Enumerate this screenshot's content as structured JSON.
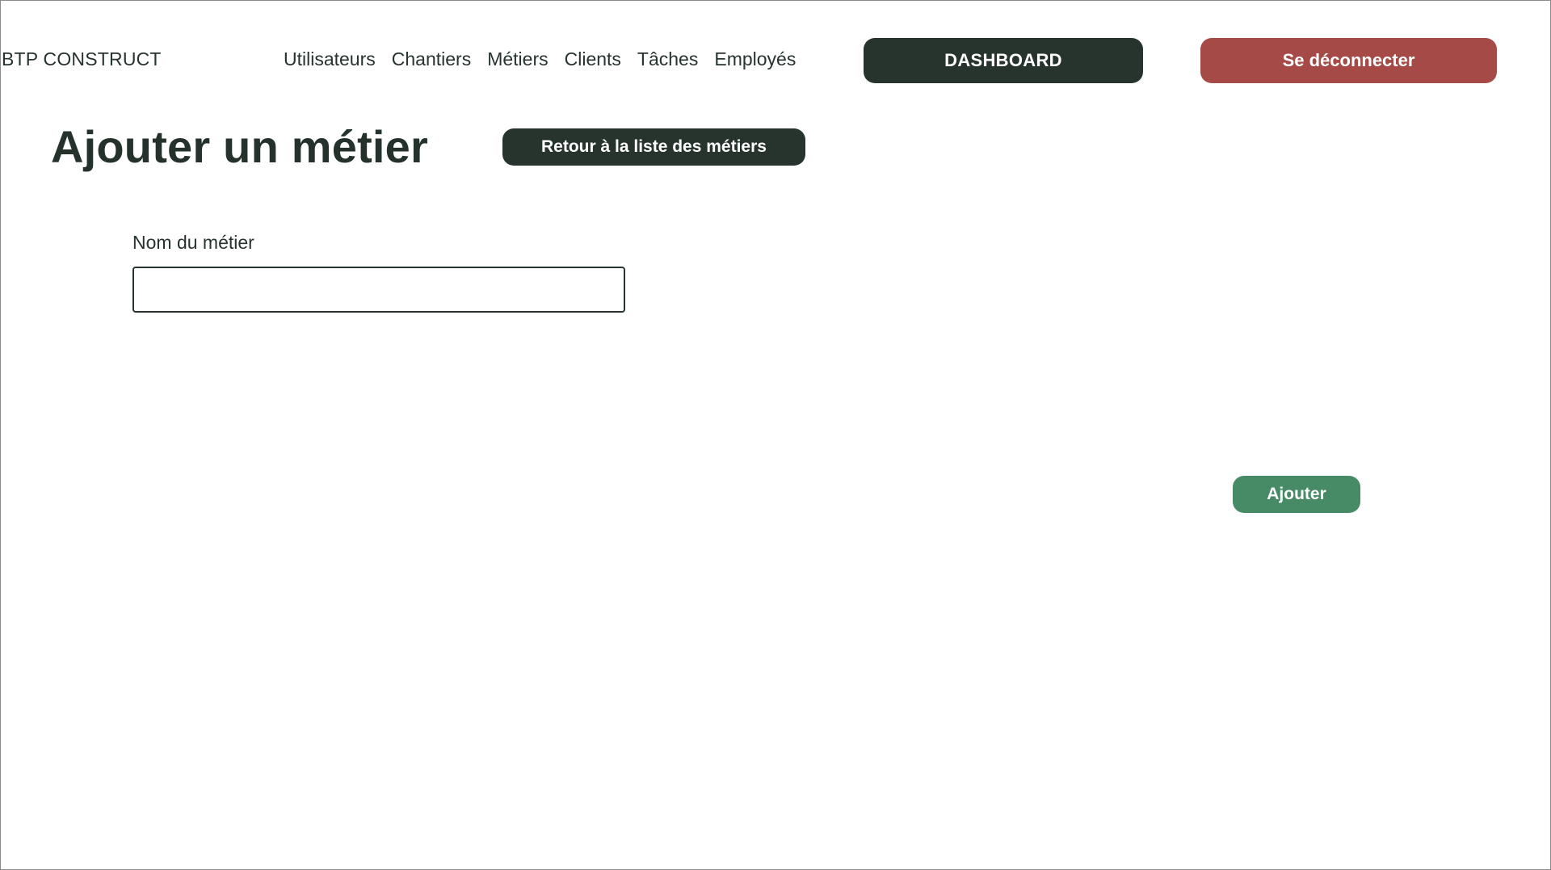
{
  "header": {
    "brand": "BTP CONSTRUCT",
    "nav": [
      {
        "label": "Utilisateurs"
      },
      {
        "label": "Chantiers"
      },
      {
        "label": "Métiers"
      },
      {
        "label": "Clients"
      },
      {
        "label": "Tâches"
      },
      {
        "label": "Employés"
      }
    ],
    "dashboard_label": "DASHBOARD",
    "logout_label": "Se déconnecter"
  },
  "main": {
    "title": "Ajouter un métier",
    "back_label": "Retour à la liste des métiers",
    "form": {
      "name_label": "Nom du métier",
      "name_value": "",
      "name_placeholder": "",
      "submit_label": "Ajouter"
    }
  },
  "colors": {
    "dark": "#27342e",
    "danger": "#a54a47",
    "success": "#478a66"
  }
}
